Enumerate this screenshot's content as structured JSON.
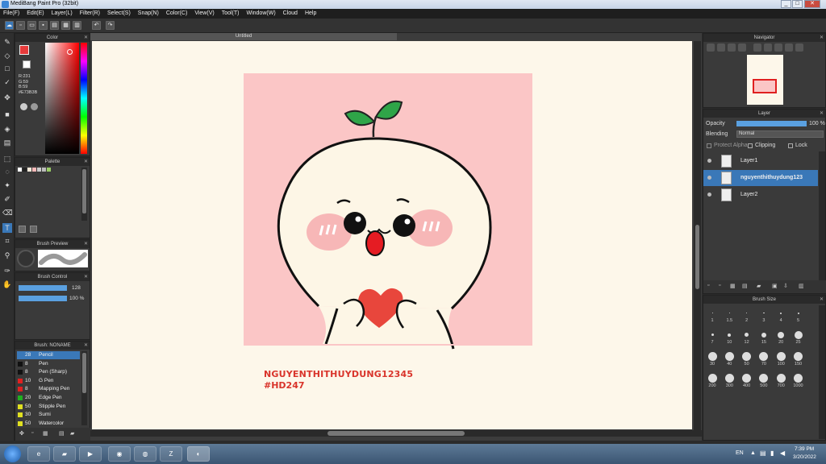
{
  "window": {
    "title": "MediBang Paint Pro (32bit)",
    "min": "_",
    "max": "□",
    "close": "✕"
  },
  "menu": [
    "File(F)",
    "Edit(E)",
    "Layer(L)",
    "Filter(R)",
    "Select(S)",
    "Snap(N)",
    "Color(C)",
    "View(V)",
    "Tool(T)",
    "Window(W)",
    "Cloud",
    "Help"
  ],
  "toolbar": {
    "undo": "↶",
    "redo": "↷"
  },
  "color_panel": {
    "title": "Color",
    "r": "R:231",
    "g": "G:59",
    "b": "B:59",
    "hex": "#E73B3B",
    "primary": "#E73B3B"
  },
  "palette_panel": {
    "title": "Palette"
  },
  "brush_preview": {
    "title": "Brush Preview"
  },
  "brush_control": {
    "title": "Brush Control",
    "size": "128",
    "opacity": "100 %"
  },
  "brush_list": {
    "title": "Brush: NONAME",
    "items": [
      {
        "size": "28",
        "name": "Pencil",
        "color": "#3a78b8",
        "selected": true
      },
      {
        "size": "8",
        "name": "Pen",
        "color": "#111111"
      },
      {
        "size": "8",
        "name": "Pen (Sharp)",
        "color": "#111111"
      },
      {
        "size": "10",
        "name": "G Pen",
        "color": "#e02020"
      },
      {
        "size": "8",
        "name": "Mapping Pen",
        "color": "#e02020"
      },
      {
        "size": "20",
        "name": "Edge Pen",
        "color": "#20b020"
      },
      {
        "size": "50",
        "name": "Stipple Pen",
        "color": "#e0e020"
      },
      {
        "size": "30",
        "name": "Sumi",
        "color": "#e0e020"
      },
      {
        "size": "50",
        "name": "Watercolor",
        "color": "#e0e020"
      }
    ]
  },
  "document": {
    "tab": "Untitled",
    "caption_line1": "NGUYENTHITHUYDUNG12345",
    "caption_line2": "#HD247"
  },
  "navigator": {
    "title": "Navigator"
  },
  "layer_panel": {
    "title": "Layer",
    "opacity_label": "Opacity",
    "opacity_value": "100 %",
    "blending_label": "Blending",
    "blending_value": "Normal",
    "protect_alpha": "Protect Alpha",
    "clipping": "Clipping",
    "lock": "Lock",
    "layers": [
      {
        "name": "Layer1"
      },
      {
        "name": "nguyenthithuydung123",
        "selected": true
      },
      {
        "name": "Layer2"
      }
    ]
  },
  "brush_size": {
    "title": "Brush Size",
    "sizes": [
      "1",
      "1.5",
      "2",
      "3",
      "4",
      "5",
      "7",
      "10",
      "12",
      "15",
      "20",
      "25",
      "30",
      "40",
      "50",
      "70",
      "100",
      "150",
      "200",
      "300",
      "400",
      "500",
      "700",
      "1000"
    ]
  },
  "taskbar": {
    "lang": "EN",
    "time": "7:39 PM",
    "date": "3/20/2022"
  }
}
